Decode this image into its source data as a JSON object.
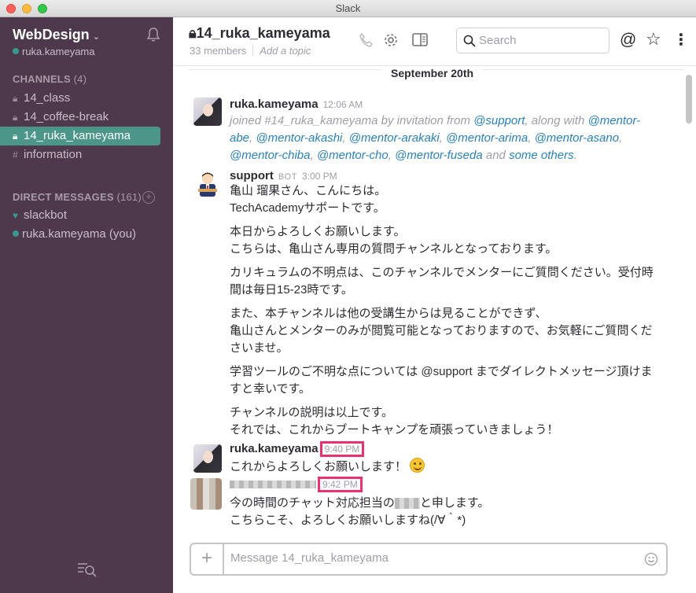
{
  "window": {
    "title": "Slack"
  },
  "sidebar": {
    "team_name": "WebDesign",
    "user": "ruka.kameyama",
    "channels_header": "CHANNELS",
    "channels_count": "(4)",
    "channels": [
      {
        "label": "14_class",
        "prefix": "lock"
      },
      {
        "label": "14_coffee-break",
        "prefix": "lock"
      },
      {
        "label": "14_ruka_kameyama",
        "prefix": "lock",
        "active": true
      },
      {
        "label": "information",
        "prefix": "#"
      }
    ],
    "dm_header": "DIRECT MESSAGES",
    "dm_count": "(161)",
    "dms": [
      {
        "label": "slackbot"
      },
      {
        "label": "ruka.kameyama (you)"
      }
    ]
  },
  "header": {
    "channel_name": "14_ruka_kameyama",
    "members": "33 members",
    "topic": "Add a topic",
    "search_placeholder": "Search"
  },
  "messages": {
    "day_divider": "September 20th",
    "m1": {
      "author": "ruka.kameyama",
      "time": "12:06 AM",
      "text_a": "joined #14_ruka_kameyama by invitation from ",
      "mention_support": "@support",
      "text_b": ", along with ",
      "mentions": [
        "@mentor-abe",
        "@mentor-akashi",
        "@mentor-arakaki",
        "@mentor-arima",
        "@mentor-asano",
        "@mentor-chiba",
        "@mentor-cho",
        "@mentor-fuseda"
      ],
      "text_and": " and ",
      "others": "some others",
      "text_end": "."
    },
    "m2": {
      "author": "support",
      "badge": "BOT",
      "time": "3:00 PM",
      "lines": [
        "亀山 瑠果さん、こんにちは。",
        "TechAcademyサポートです。",
        "本日からよろしくお願いします。",
        "こちらは、亀山さん専用の質問チャンネルとなっております。",
        "カリキュラムの不明点は、このチャンネルでメンターにご質問ください。受付時",
        "間は毎日15-23時です。",
        "また、本チャンネルは他の受講生からは見ることができず、",
        "亀山さんとメンターのみが閲覧可能となっておりますので、お気軽にご質問くだ",
        "さいませ。",
        "学習ツールのご不明な点については @support までダイレクトメッセージ頂けま",
        "すと幸いです。",
        "チャンネルの説明は以上です。",
        "それでは、これからブートキャンプを頑張っていきましょう！"
      ]
    },
    "m3": {
      "author": "ruka.kameyama",
      "time": "9:40 PM",
      "text": "これからよろしくお願いします！"
    },
    "m4": {
      "time": "9:42 PM",
      "line1_a": "今の時間のチャット対応担当の",
      "line1_b": "と申します。",
      "line2": "こちらこそ、よろしくお願いしますね(/∀｀*)"
    }
  },
  "composer": {
    "placeholder": "Message 14_ruka_kameyama"
  },
  "colors": {
    "sidebar": "#4d394b",
    "active": "#4c9689",
    "mention": "#2a80b9",
    "highlight": "#e8336f"
  }
}
